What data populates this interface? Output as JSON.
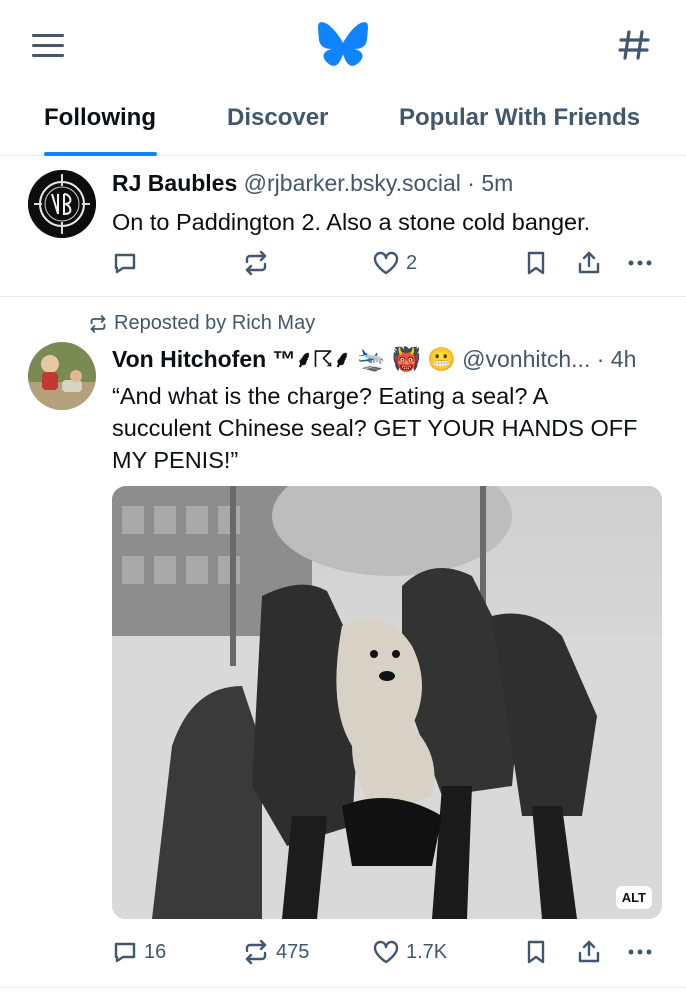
{
  "header": {
    "menu_icon": "hamburger-menu-icon",
    "logo_icon": "butterfly-logo",
    "feeds_icon": "hashtag-icon",
    "accent_color": "#1083fe"
  },
  "tabs": [
    {
      "label": "Following",
      "active": true
    },
    {
      "label": "Discover",
      "active": false
    },
    {
      "label": "Popular With Friends",
      "active": false
    }
  ],
  "posts": [
    {
      "author": "RJ Baubles",
      "handle": "@rjbarker.bsky.social",
      "time": "· 5m",
      "text": "On to Paddington 2. Also a stone cold banger.",
      "reply_count": "",
      "repost_count": "",
      "like_count": "2"
    },
    {
      "repost_label": "Reposted by Rich May",
      "author": "Von Hitchofen ™⸙☈⸙ 🛬 👹 😬",
      "handle": "@vonhitch...",
      "time": "· 4h",
      "text_lines": [
        "“And what is the charge? Eating a seal? A",
        "succulent Chinese seal? GET YOUR HANDS OFF",
        "MY PENIS!”"
      ],
      "image_alt_badge": "ALT",
      "reply_count": "16",
      "repost_count": "475",
      "like_count": "1.7K"
    }
  ]
}
